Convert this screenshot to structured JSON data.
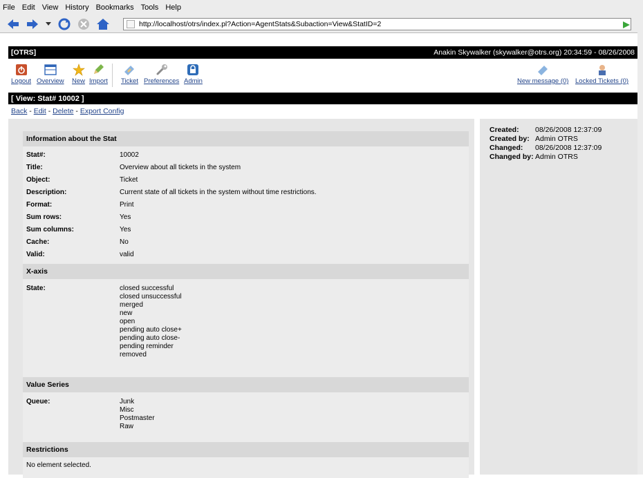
{
  "browser": {
    "menu": [
      "File",
      "Edit",
      "View",
      "History",
      "Bookmarks",
      "Tools",
      "Help"
    ],
    "url": "http://localhost/otrs/index.pl?Action=AgentStats&Subaction=View&StatID=2"
  },
  "header": {
    "app": "[OTRS]",
    "user_info": "Anakin Skywalker (skywalker@otrs.org) 20:34:59 - 08/26/2008"
  },
  "toolbar": {
    "logout": "Logout",
    "overview": "Overview",
    "new": "New",
    "import": "Import",
    "ticket": "Ticket",
    "preferences": "Preferences",
    "admin": "Admin",
    "new_message": "New message (0)",
    "locked_tickets": "Locked Tickets (0)"
  },
  "view_title": "[ View: Stat# 10002 ]",
  "actions": {
    "back": "Back",
    "edit": "Edit",
    "delete": "Delete",
    "export": "Export Config",
    "sep": " - "
  },
  "info": {
    "heading": "Information about the Stat",
    "rows": [
      {
        "k": "Stat#:",
        "v": "10002"
      },
      {
        "k": "Title:",
        "v": "Overview about all tickets in the system"
      },
      {
        "k": "Object:",
        "v": "Ticket"
      },
      {
        "k": "Description:",
        "v": "Current state of all tickets in the system without time restrictions."
      },
      {
        "k": "Format:",
        "v": "Print"
      },
      {
        "k": "Sum rows:",
        "v": "Yes"
      },
      {
        "k": "Sum columns:",
        "v": "Yes"
      },
      {
        "k": "Cache:",
        "v": "No"
      },
      {
        "k": "Valid:",
        "v": "valid"
      }
    ]
  },
  "xaxis": {
    "heading": "X-axis",
    "key": "State:",
    "values": [
      "closed successful",
      "closed unsuccessful",
      "merged",
      "new",
      "open",
      "pending auto close+",
      "pending auto close-",
      "pending reminder",
      "removed"
    ]
  },
  "value_series": {
    "heading": "Value Series",
    "key": "Queue:",
    "values": [
      "Junk",
      "Misc",
      "Postmaster",
      "Raw"
    ]
  },
  "restrictions": {
    "heading": "Restrictions",
    "text": "No element selected."
  },
  "side": [
    {
      "k": "Created:",
      "v": "08/26/2008 12:37:09"
    },
    {
      "k": "Created by:",
      "v": "Admin OTRS"
    },
    {
      "k": "Changed:",
      "v": "08/26/2008 12:37:09"
    },
    {
      "k": "Changed by:",
      "v": "Admin OTRS"
    }
  ]
}
